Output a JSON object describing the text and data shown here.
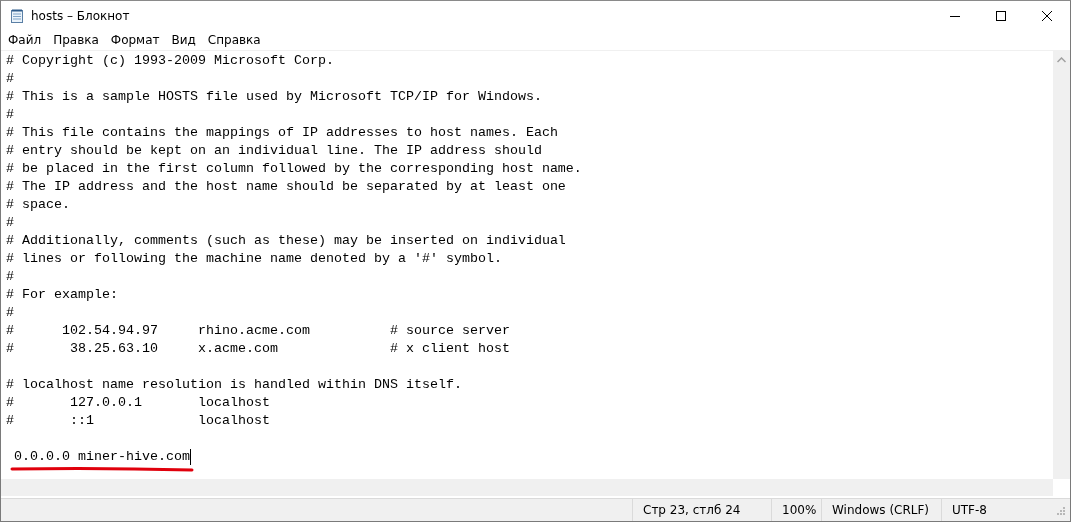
{
  "window": {
    "title": "hosts – Блокнот"
  },
  "menu": [
    "Файл",
    "Правка",
    "Формат",
    "Вид",
    "Справка"
  ],
  "editor": {
    "blocks": [
      [
        "# Copyright (c) 1993-2009 Microsoft Corp.",
        "#",
        "# This is a sample HOSTS file used by Microsoft TCP/IP for Windows.",
        "#",
        "# This file contains the mappings of IP addresses to host names. Each",
        "# entry should be kept on an individual line. The IP address should",
        "# be placed in the first column followed by the corresponding host name.",
        "# The IP address and the host name should be separated by at least one",
        "# space.",
        "#",
        "# Additionally, comments (such as these) may be inserted on individual",
        "# lines or following the machine name denoted by a '#' symbol.",
        "#",
        "# For example:",
        "#",
        "#      102.54.94.97     rhino.acme.com          # source server",
        "#       38.25.63.10     x.acme.com              # x client host"
      ],
      [
        "# localhost name resolution is handled within DNS itself.",
        "#       127.0.0.1       localhost",
        "#       ::1             localhost"
      ],
      [
        " 0.0.0.0 miner-hive.com"
      ]
    ]
  },
  "status_bar": [
    "Стр 23, стлб 24",
    "100%",
    "Windows (CRLF)",
    "UTF-8"
  ]
}
